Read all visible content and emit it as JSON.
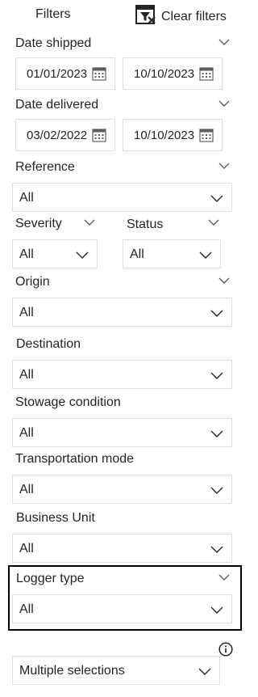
{
  "header": {
    "title": "Filters",
    "clear_label": "Clear filters"
  },
  "date_shipped": {
    "label": "Date shipped",
    "start": "01/01/2023",
    "end": "10/10/2023"
  },
  "date_delivered": {
    "label": "Date delivered",
    "start": "03/02/2022",
    "end": "10/10/2023"
  },
  "reference": {
    "label": "Reference",
    "value": "All"
  },
  "severity": {
    "label": "Severity",
    "value": "All"
  },
  "status": {
    "label": "Status",
    "value": "All"
  },
  "origin": {
    "label": "Origin",
    "value": "All"
  },
  "destination": {
    "label": "Destination",
    "value": "All"
  },
  "stowage_condition": {
    "label": "Stowage condition",
    "value": "All"
  },
  "transportation_mode": {
    "label": "Transportation mode",
    "value": "All"
  },
  "business_unit": {
    "label": "Business Unit",
    "value": "All"
  },
  "logger_type": {
    "label": "Logger type",
    "value": "All"
  },
  "multi_select": {
    "value": "Multiple selections"
  },
  "icons": {
    "clear": "clear-filter-icon",
    "calendar": "calendar-icon",
    "chevron": "chevron-down-icon",
    "info": "info-icon"
  },
  "colors": {
    "text": "#252423",
    "border": "#e1dfdd",
    "highlight_border": "#000000"
  }
}
